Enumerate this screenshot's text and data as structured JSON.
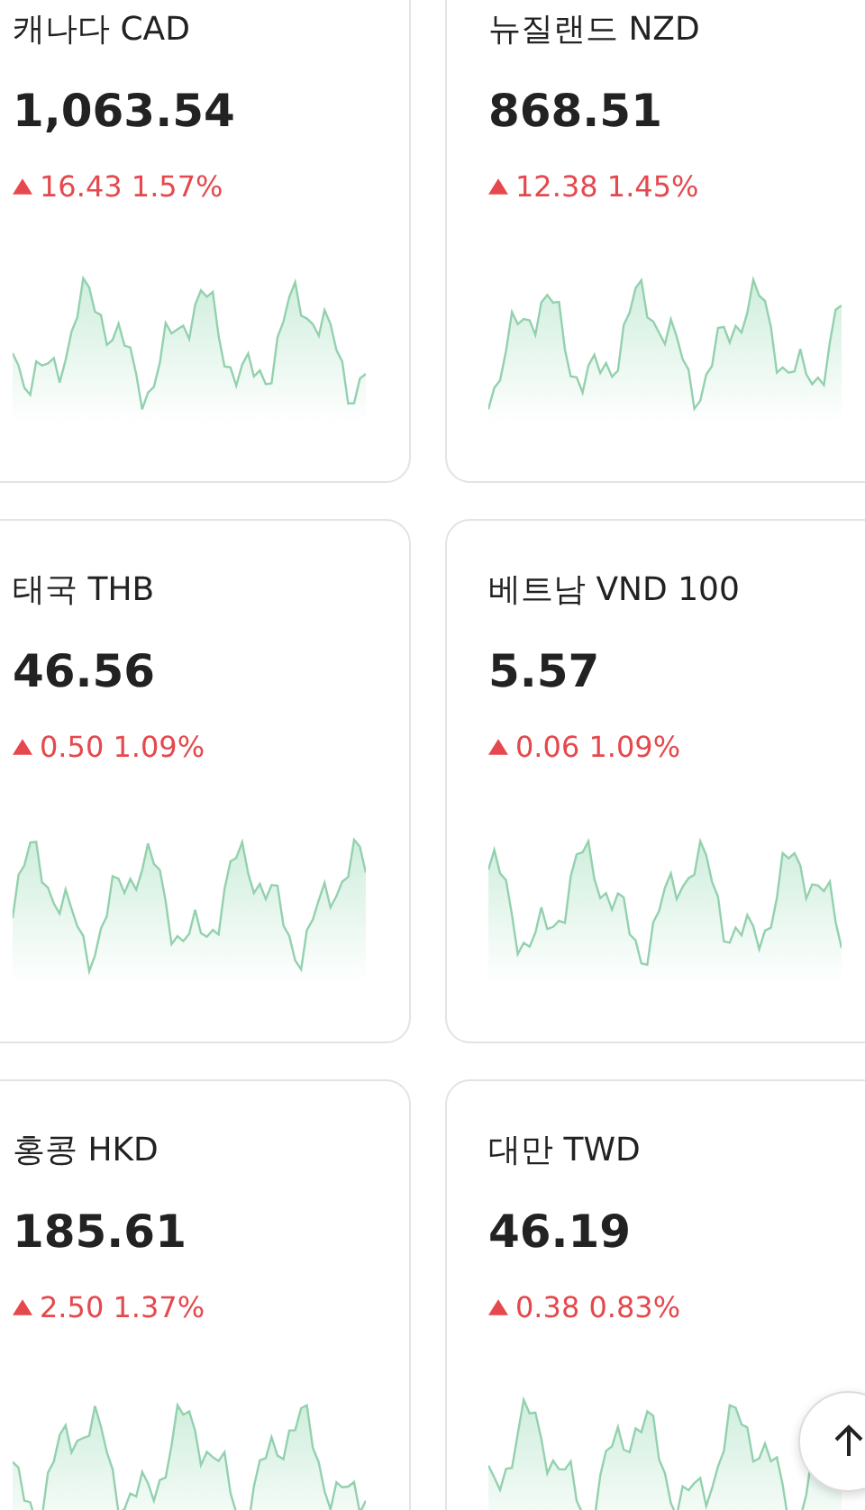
{
  "cards": [
    {
      "title": "캐나다 CAD",
      "value": "1,063.54",
      "rising": true,
      "change": "16.43 1.57%"
    },
    {
      "title": "뉴질랜드 NZD",
      "value": "868.51",
      "rising": true,
      "change": "12.38 1.45%"
    },
    {
      "title": "태국 THB",
      "value": "46.56",
      "rising": true,
      "change": "0.50 1.09%"
    },
    {
      "title": "베트남 VND 100",
      "value": "5.57",
      "rising": true,
      "change": "0.06 1.09%"
    },
    {
      "title": "홍콩 HKD",
      "value": "185.61",
      "rising": true,
      "change": "2.50 1.37%"
    },
    {
      "title": "대만 TWD",
      "value": "46.19",
      "rising": true,
      "change": "0.38 0.83%"
    }
  ]
}
